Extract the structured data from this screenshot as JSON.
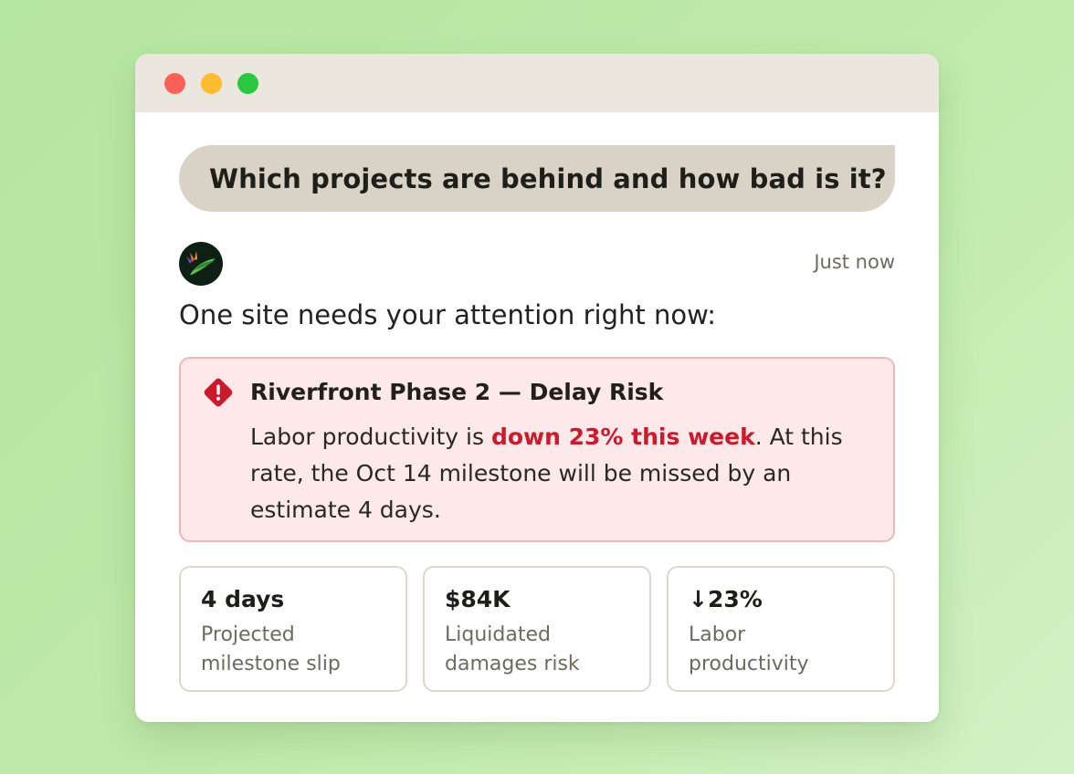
{
  "window": {
    "controls": [
      "close",
      "minimize",
      "maximize"
    ]
  },
  "chat": {
    "user_message": "Which projects are behind and how bad is it?",
    "assistant": {
      "avatar_icon": "bird-of-paradise-logo-icon",
      "timestamp": "Just now",
      "lead": "One site needs your attention right now:"
    }
  },
  "alert": {
    "icon": "warning-diamond-icon",
    "color": "#cc1a2b",
    "title": "Riverfront Phase 2 — Delay Risk",
    "body_prefix": "Labor productivity is ",
    "body_highlight": "down 23% this week",
    "body_suffix": ". At this rate, the Oct 14 milestone will be missed by an estimate 4 days."
  },
  "stats": [
    {
      "value": "4 days",
      "label": "Projected milestone slip"
    },
    {
      "value": "$84K",
      "label": "Liquidated damages risk"
    },
    {
      "value": "↓23%",
      "label": "Labor productivity"
    }
  ]
}
